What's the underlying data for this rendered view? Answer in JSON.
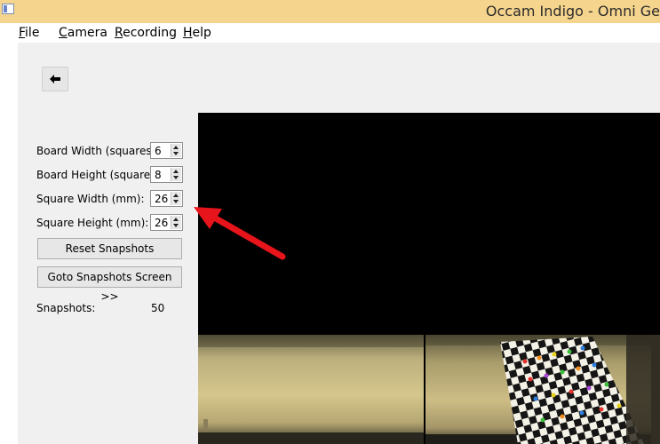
{
  "window": {
    "title": "Occam Indigo - Omni Ge"
  },
  "menu": [
    {
      "label": "File",
      "mnemonic": "F",
      "rest": "ile"
    },
    {
      "label": "Camera",
      "mnemonic": "C",
      "rest": "amera"
    },
    {
      "label": "Recording",
      "mnemonic": "R",
      "rest": "ecording"
    },
    {
      "label": "Help",
      "mnemonic": "H",
      "rest": "elp"
    }
  ],
  "toolbar": {
    "back_icon": "arrow-left-icon"
  },
  "settings": {
    "board_width": {
      "label": "Board Width (squares-:",
      "value": "6"
    },
    "board_height": {
      "label": "Board Height (squares-",
      "value": "8"
    },
    "square_width": {
      "label": "Square Width (mm):",
      "value": "26"
    },
    "square_height": {
      "label": "Square Height (mm):",
      "value": "26"
    }
  },
  "buttons": {
    "reset": "Reset Snapshots",
    "goto": "Goto Snapshots Screen >>"
  },
  "snapshots": {
    "label": "Snapshots:",
    "count": "50"
  },
  "colors": {
    "titlebar": "#f5d48e",
    "annotation_arrow": "#e8141b",
    "video_bg": "#000000"
  }
}
